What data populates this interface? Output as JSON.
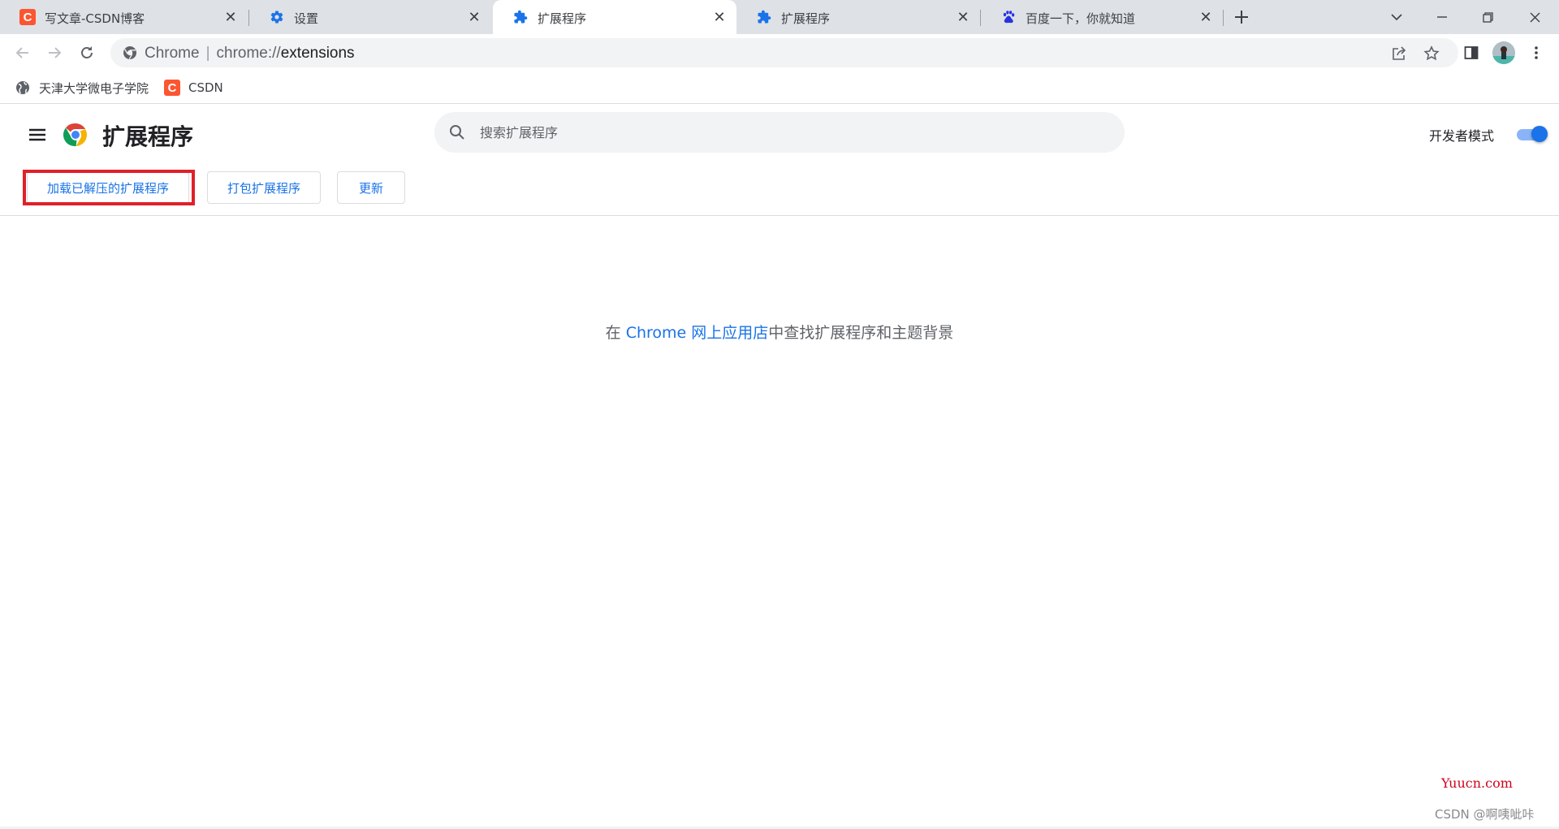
{
  "tabs": [
    {
      "title": "写文章-CSDN博客",
      "icon": "csdn-icon",
      "icon_letter": "C"
    },
    {
      "title": "设置",
      "icon": "settings-gear-icon"
    },
    {
      "title": "扩展程序",
      "icon": "puzzle-icon",
      "active": true
    },
    {
      "title": "扩展程序",
      "icon": "puzzle-icon"
    },
    {
      "title": "百度一下，你就知道",
      "icon": "baidu-paw-icon"
    }
  ],
  "window_controls": {
    "tab_search": "tab-search-icon",
    "minimize": "minimize-icon",
    "restore": "restore-icon",
    "close": "close-icon"
  },
  "omnibox": {
    "site_label": "Chrome",
    "url_host": "chrome://",
    "url_path": "extensions"
  },
  "bookmarks": [
    {
      "label": "天津大学微电子学院",
      "icon": "globe-icon"
    },
    {
      "label": "CSDN",
      "icon": "csdn-icon",
      "icon_letter": "C"
    }
  ],
  "header": {
    "title": "扩展程序",
    "search_placeholder": "搜索扩展程序",
    "dev_mode_label": "开发者模式",
    "dev_mode_on": true
  },
  "actions": {
    "load_unpacked": "加载已解压的扩展程序",
    "pack": "打包扩展程序",
    "update": "更新"
  },
  "empty_state": {
    "prefix": "在 ",
    "link": "Chrome 网上应用店",
    "suffix": "中查找扩展程序和主题背景"
  },
  "watermarks": {
    "site": "Yuucn.com",
    "author": "CSDN @啊咦呲咔"
  },
  "colors": {
    "accent": "#1a73e8",
    "highlight_box": "#e0202a",
    "csdn_brand": "#fc5531"
  }
}
